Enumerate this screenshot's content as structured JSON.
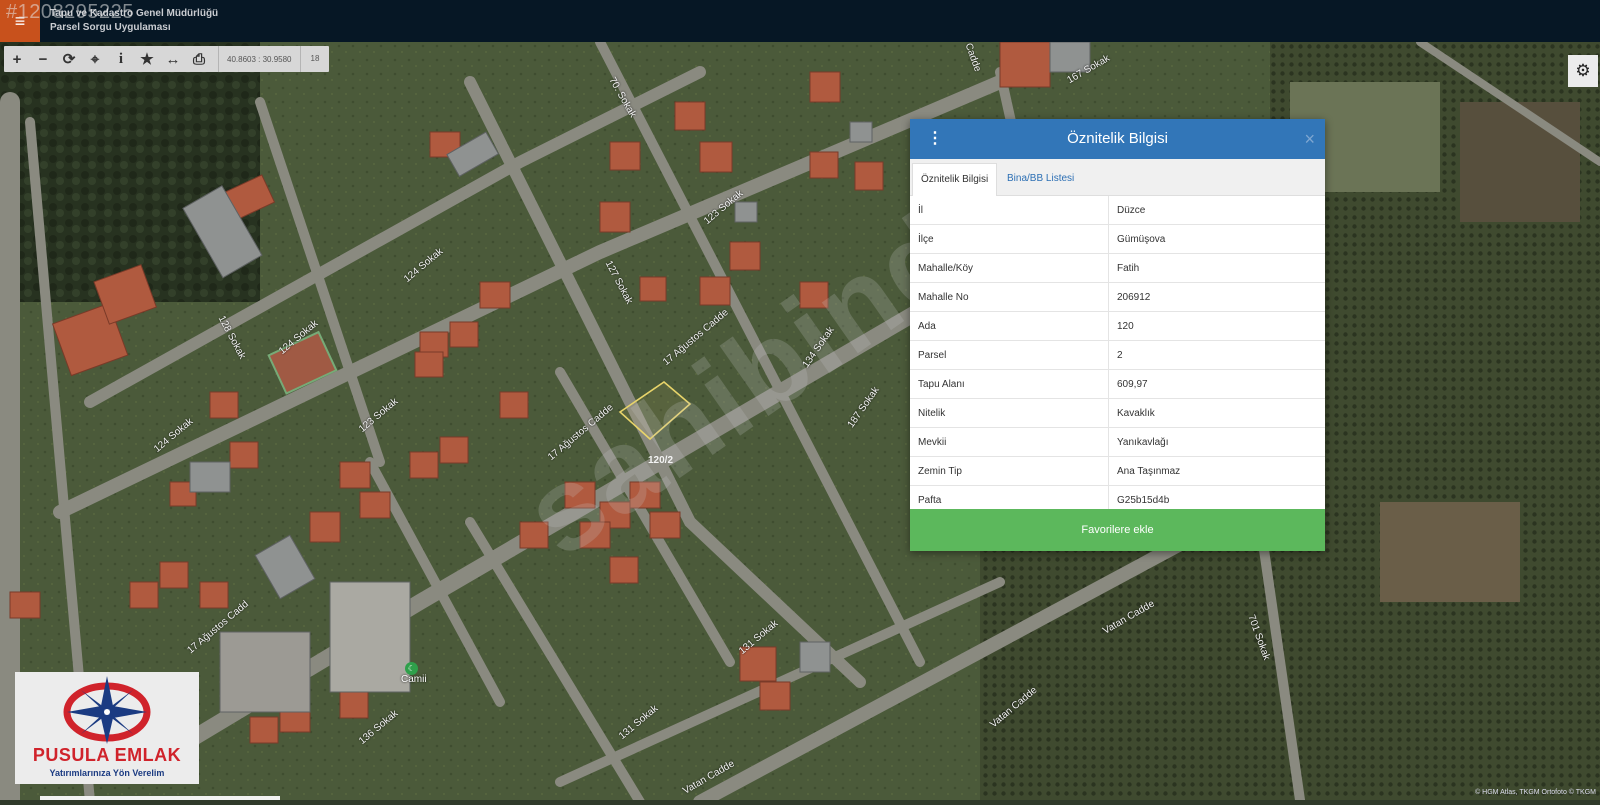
{
  "header": {
    "listing_id": "#1208295225",
    "title_line1": "Tapu ve Kadastro Genel Müdürlüğü",
    "title_line2": "Parsel Sorgu Uygulaması"
  },
  "toolbar": {
    "buttons": [
      "zoom-in",
      "zoom-out",
      "refresh",
      "locate",
      "info",
      "favorite",
      "measure",
      "print"
    ],
    "coordinates": "40.8603 : 30.9580",
    "zoom": "18"
  },
  "map": {
    "parcel_label": "120/2",
    "watermark": "sahibinden",
    "poi_label": "Camii",
    "attribution": "© HGM Atlas, TKGM Ortofoto © TKGM",
    "street_labels": [
      "70. Sokak",
      "123 Sokak",
      "127 Sokak",
      "124 Sokak",
      "124 Sokak",
      "128 Sokak",
      "124 Sokak",
      "123 Sokak",
      "17 Ağustos Cadde",
      "17 Ağustos Cadde",
      "134 Sokak",
      "187 Sokak",
      "17 Ağustos Cadd",
      "131 Sokak",
      "131 Sokak",
      "136 Sokak",
      "Vatan Cadde",
      "Vatan Cadde",
      "701 Sokak",
      "167 Sokak",
      "Cadde",
      "Vatan Cadde"
    ]
  },
  "logo": {
    "name": "PUSULA EMLAK",
    "slogan": "Yatırımlarınıza Yön Verelim"
  },
  "dialog": {
    "title": "Öznitelik Bilgisi",
    "tabs": [
      "Öznitelik Bilgisi",
      "Bina/BB Listesi"
    ],
    "rows": [
      {
        "key": "İl",
        "value": "Düzce"
      },
      {
        "key": "İlçe",
        "value": "Gümüşova"
      },
      {
        "key": "Mahalle/Köy",
        "value": "Fatih"
      },
      {
        "key": "Mahalle No",
        "value": "206912"
      },
      {
        "key": "Ada",
        "value": "120"
      },
      {
        "key": "Parsel",
        "value": "2"
      },
      {
        "key": "Tapu Alanı",
        "value": "609,97"
      },
      {
        "key": "Nitelik",
        "value": "Kavaklık"
      },
      {
        "key": "Mevkii",
        "value": "Yanıkavlağı"
      },
      {
        "key": "Zemin Tip",
        "value": "Ana Taşınmaz"
      },
      {
        "key": "Pafta",
        "value": "G25b15d4b"
      }
    ],
    "favorite_button": "Favorilere ekle"
  },
  "colors": {
    "header_bg": "#061725",
    "menu_accent": "#c8511c",
    "dialog_header": "#3276b8",
    "favorite_green": "#5cb85c",
    "parcel_outline": "#e8d46a"
  }
}
